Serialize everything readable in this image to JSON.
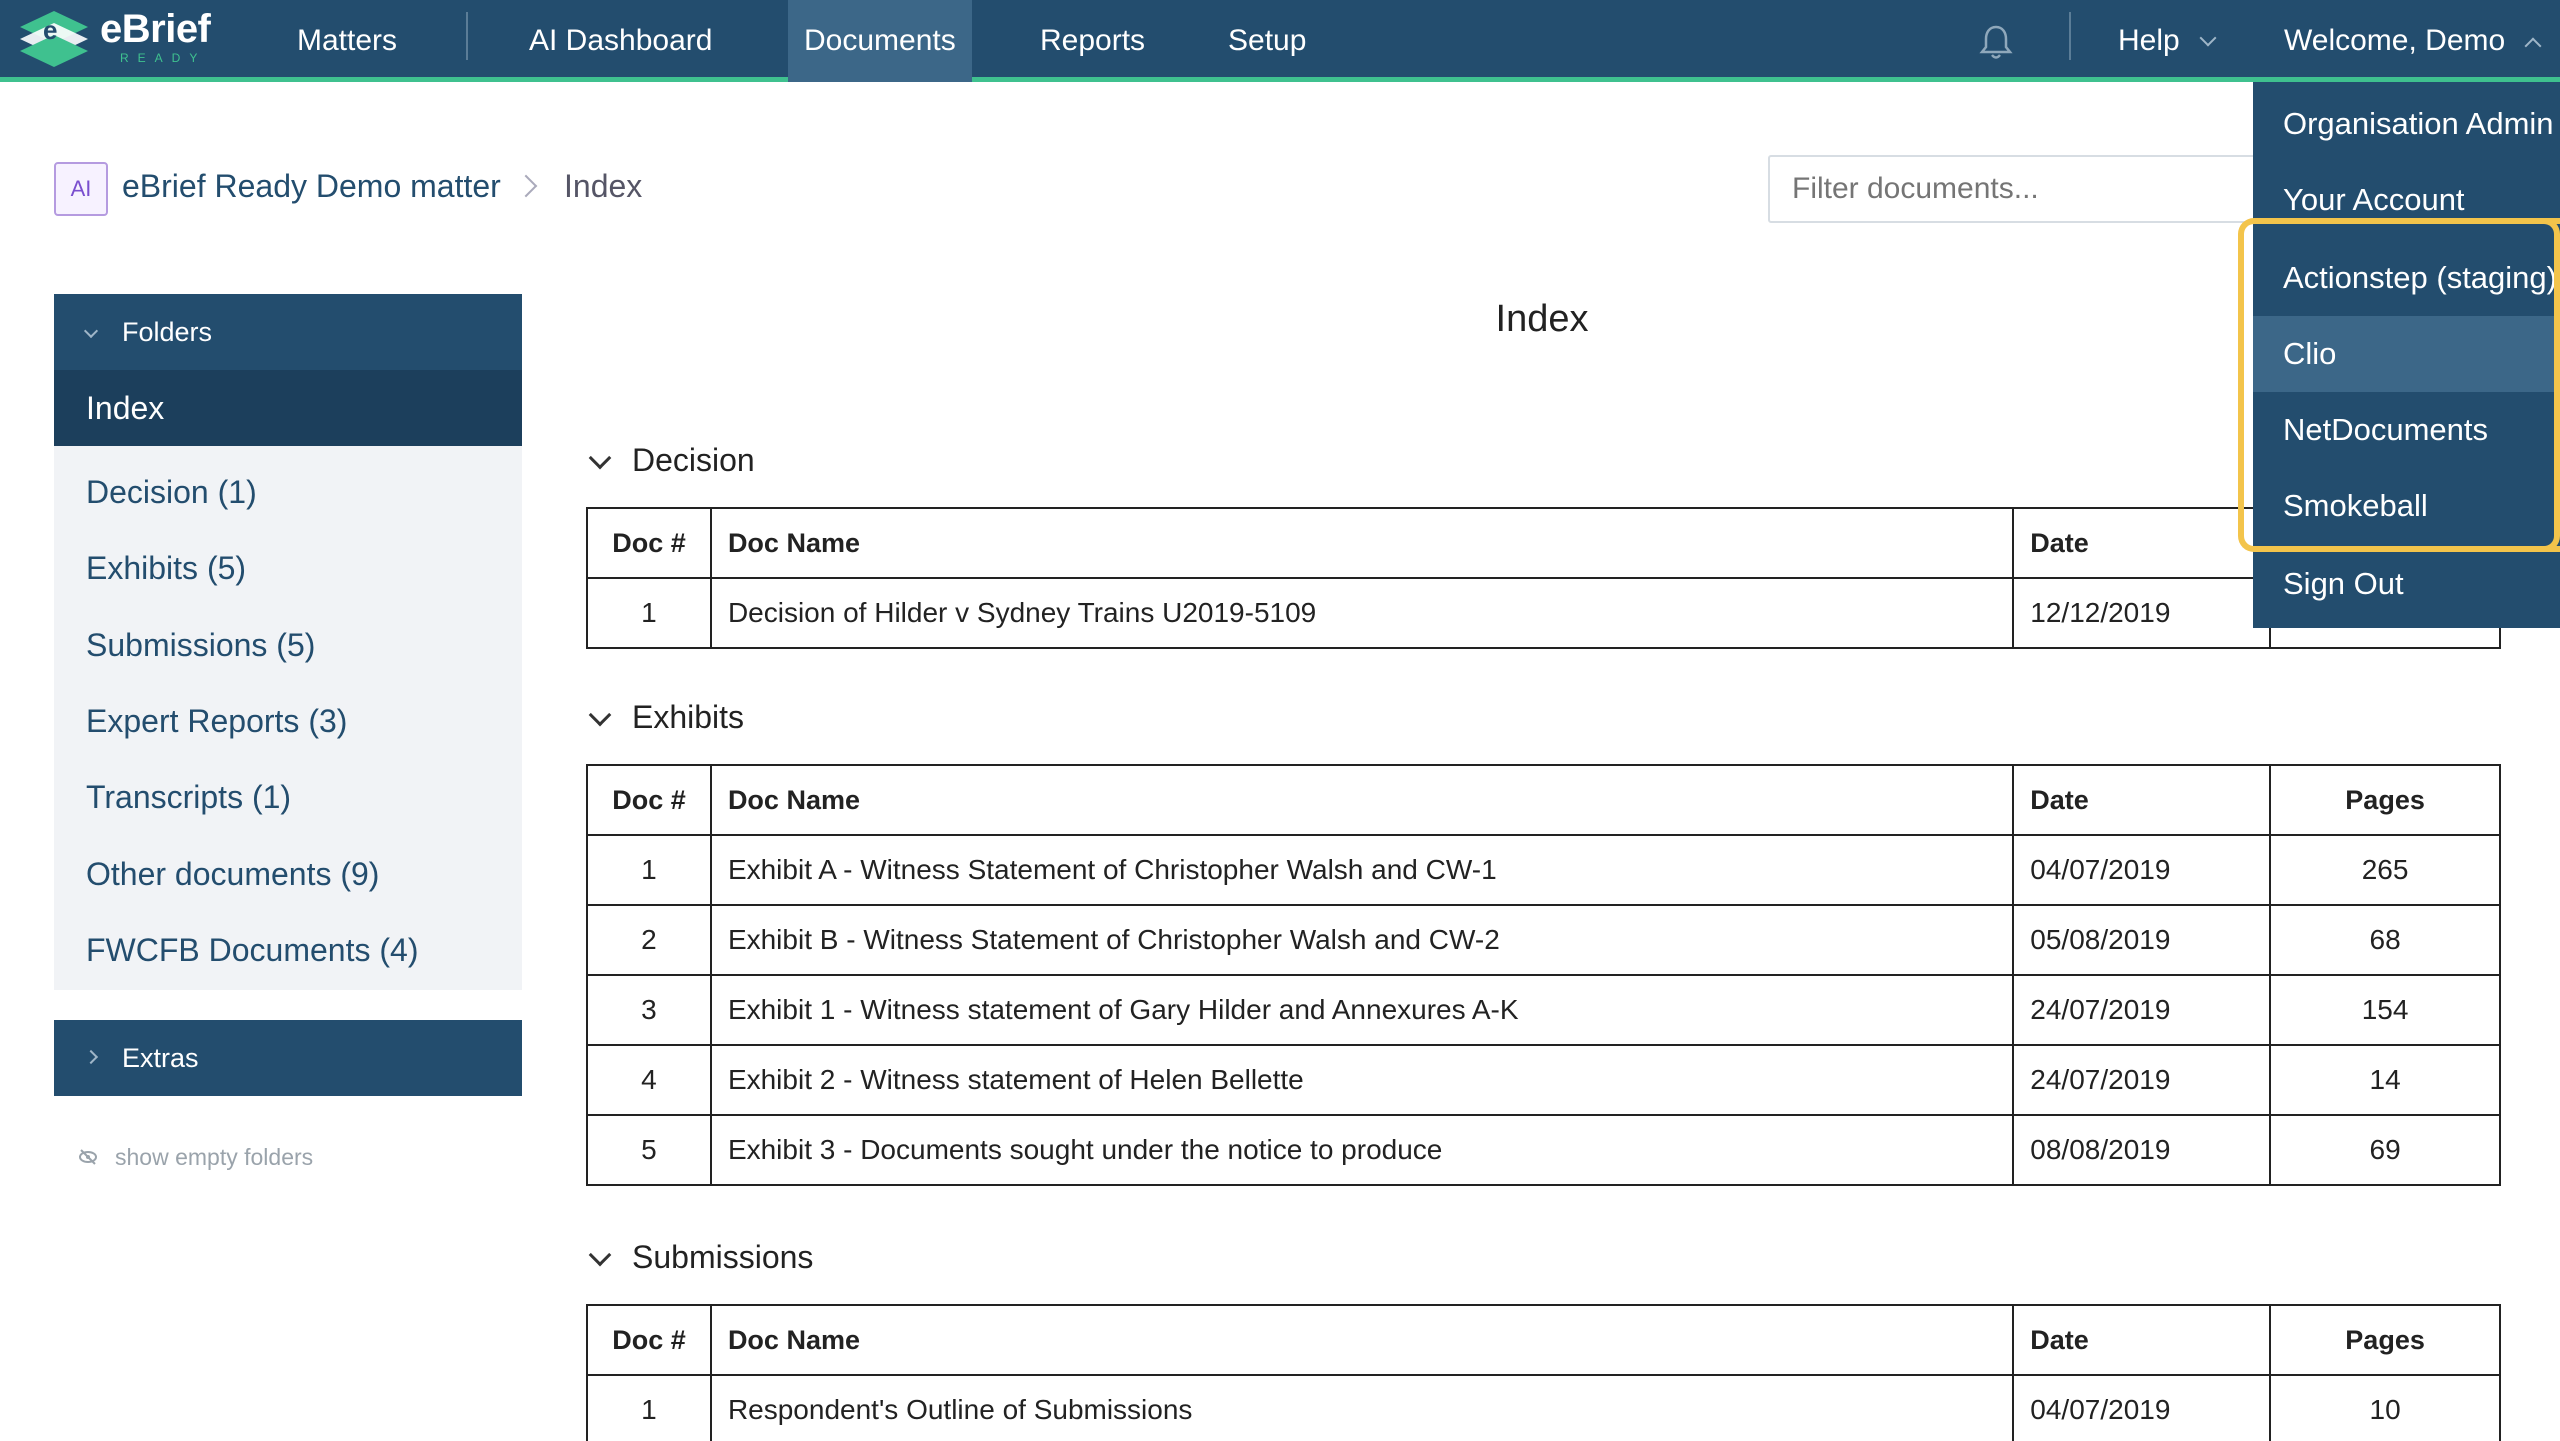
{
  "brand": {
    "title": "eBrief",
    "subtitle": "READY"
  },
  "nav": {
    "items": [
      "Matters",
      "AI Dashboard",
      "Documents",
      "Reports",
      "Setup"
    ],
    "active": "Documents",
    "help_label": "Help",
    "welcome_label": "Welcome, Demo"
  },
  "breadcrumb": {
    "badge": "AI",
    "matter": "eBrief Ready Demo matter",
    "current": "Index"
  },
  "filter": {
    "placeholder": "Filter documents..."
  },
  "sidebar": {
    "folders_label": "Folders",
    "active_item": "Index",
    "items": [
      "Decision (1)",
      "Exhibits (5)",
      "Submissions (5)",
      "Expert Reports (3)",
      "Transcripts (1)",
      "Other documents (9)",
      "FWCFB Documents (4)"
    ],
    "extras_label": "Extras",
    "show_empty_label": "show empty folders"
  },
  "main": {
    "title": "Index",
    "columns": {
      "num": "Doc #",
      "name": "Doc Name",
      "date": "Date",
      "pages": "Pages"
    },
    "sections": [
      {
        "title": "Decision",
        "rows": [
          {
            "num": "1",
            "name": "Decision of Hilder v Sydney Trains U2019-5109",
            "date": "12/12/2019",
            "pages": ""
          }
        ]
      },
      {
        "title": "Exhibits",
        "rows": [
          {
            "num": "1",
            "name": "Exhibit A - Witness Statement of Christopher Walsh and CW-1",
            "date": "04/07/2019",
            "pages": "265"
          },
          {
            "num": "2",
            "name": "Exhibit B - Witness Statement of Christopher Walsh and CW-2",
            "date": "05/08/2019",
            "pages": "68"
          },
          {
            "num": "3",
            "name": "Exhibit 1 - Witness statement of Gary Hilder and Annexures A-K",
            "date": "24/07/2019",
            "pages": "154"
          },
          {
            "num": "4",
            "name": "Exhibit 2 - Witness statement of Helen Bellette",
            "date": "24/07/2019",
            "pages": "14"
          },
          {
            "num": "5",
            "name": "Exhibit 3 - Documents sought under the notice to produce",
            "date": "08/08/2019",
            "pages": "69"
          }
        ]
      },
      {
        "title": "Submissions",
        "rows": [
          {
            "num": "1",
            "name": "Respondent's Outline of Submissions",
            "date": "04/07/2019",
            "pages": "10"
          }
        ]
      }
    ]
  },
  "account_menu": {
    "items": [
      "Organisation Admin",
      "Your Account",
      "Actionstep (staging)",
      "Clio",
      "NetDocuments",
      "Smokeball",
      "Sign Out"
    ],
    "hovered": "Clio"
  },
  "colors": {
    "nav_bg": "#234d6e",
    "accent": "#3fc18f",
    "highlight": "#f3c44b"
  }
}
